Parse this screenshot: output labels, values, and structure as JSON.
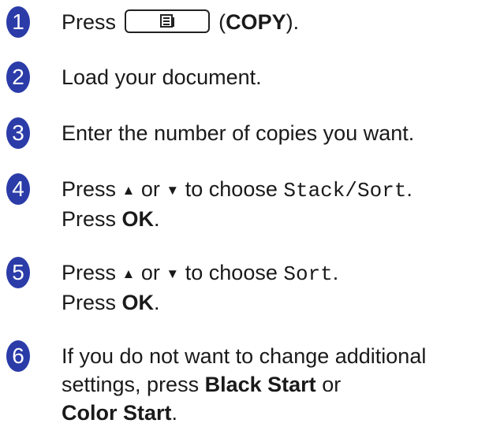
{
  "accent_color": "#2b3ca8",
  "steps": [
    {
      "number": "1",
      "press": "Press",
      "key_icon": "copy-key-icon",
      "key_open": "(",
      "key_label": "COPY",
      "key_close": ")."
    },
    {
      "number": "2",
      "text": "Load your document."
    },
    {
      "number": "3",
      "text": "Enter the number of copies you want."
    },
    {
      "number": "4",
      "press": "Press",
      "up": "▲",
      "or": "or",
      "down": "▼",
      "to_choose": "to choose",
      "option": "Stack/Sort",
      "period": ".",
      "press2": "Press",
      "ok": "OK",
      "period2": "."
    },
    {
      "number": "5",
      "press": "Press",
      "up": "▲",
      "or": "or",
      "down": "▼",
      "to_choose": "to choose",
      "option": "Sort",
      "period": ".",
      "press2": "Press",
      "ok": "OK",
      "period2": "."
    },
    {
      "number": "6",
      "line1": "If you do not want to change additional",
      "line2_pre": "settings, press",
      "black_start": "Black Start",
      "or": "or",
      "color_start": "Color Start",
      "period": "."
    }
  ]
}
